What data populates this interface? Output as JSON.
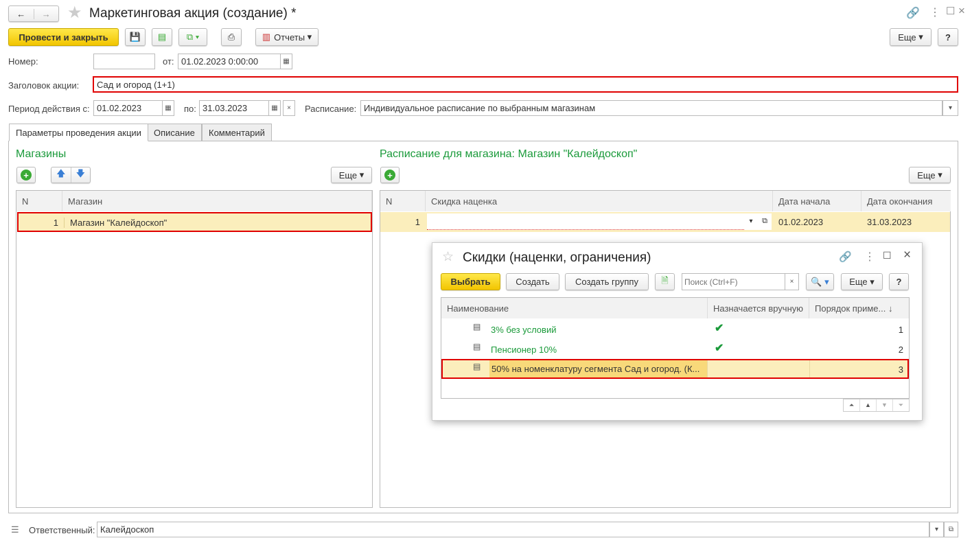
{
  "window": {
    "title": "Маркетинговая акция (создание) *",
    "back": "←",
    "forward": "→"
  },
  "toolbar": {
    "post_close": "Провести и закрыть",
    "reports": "Отчеты",
    "more": "Еще",
    "help": "?"
  },
  "header": {
    "number_label": "Номер:",
    "number_value": "",
    "from_label": "от:",
    "date_value": "01.02.2023  0:00:00",
    "title_label": "Заголовок акции:",
    "title_value": "Сад и огород (1+1)",
    "period_label": "Период действия с:",
    "period_from": "01.02.2023",
    "to_label": "по:",
    "period_to": "31.03.2023",
    "schedule_label": "Расписание:",
    "schedule_value": "Индивидуальное расписание по выбранным магазинам"
  },
  "tabs": [
    "Параметры проведения акции",
    "Описание",
    "Комментарий"
  ],
  "stores": {
    "title": "Магазины",
    "more": "Еще",
    "columns": [
      "N",
      "Магазин"
    ],
    "rows": [
      {
        "n": "1",
        "name": "Магазин \"Калейдоскоп\""
      }
    ]
  },
  "schedule": {
    "title": "Расписание для магазина: Магазин \"Калейдоскоп\"",
    "more": "Еще",
    "columns": [
      "N",
      "Скидка наценка",
      "Дата начала",
      "Дата окончания"
    ],
    "rows": [
      {
        "n": "1",
        "discount": "",
        "start": "01.02.2023",
        "end": "31.03.2023"
      }
    ]
  },
  "dialog": {
    "title": "Скидки (наценки, ограничения)",
    "select": "Выбрать",
    "create": "Создать",
    "create_group": "Создать группу",
    "search_placeholder": "Поиск (Ctrl+F)",
    "more": "Еще",
    "help": "?",
    "columns": [
      "Наименование",
      "Назначается вручную",
      "Порядок приме...  ↓"
    ],
    "rows": [
      {
        "name": "3% без условий",
        "manual": "✔",
        "order": "1"
      },
      {
        "name": "Пенсионер 10%",
        "manual": "✔",
        "order": "2"
      },
      {
        "name": "50% на номенклатуру сегмента Сад и огород. (К...",
        "manual": "",
        "order": "3"
      }
    ]
  },
  "footer": {
    "responsible_label": "Ответственный:",
    "responsible_value": "Калейдоскоп"
  }
}
